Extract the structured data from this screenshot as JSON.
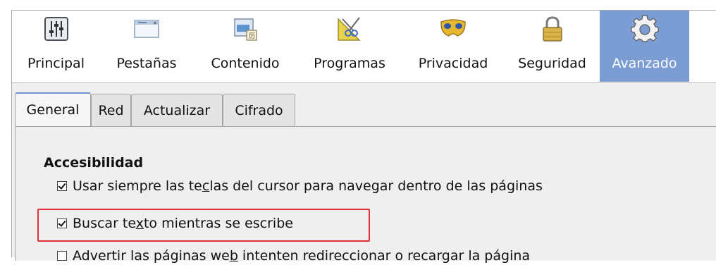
{
  "toolbar": {
    "items": [
      {
        "label": "Principal",
        "icon": "sliders-icon"
      },
      {
        "label": "Pestañas",
        "icon": "tabs-icon"
      },
      {
        "label": "Contenido",
        "icon": "content-icon"
      },
      {
        "label": "Programas",
        "icon": "applications-icon"
      },
      {
        "label": "Privacidad",
        "icon": "mask-icon"
      },
      {
        "label": "Seguridad",
        "icon": "padlock-icon"
      },
      {
        "label": "Avanzado",
        "icon": "gear-icon"
      }
    ],
    "selected": "Avanzado",
    "selected_color": "#7b9dd4"
  },
  "tabs": {
    "items": [
      "General",
      "Red",
      "Actualizar",
      "Cifrado"
    ],
    "active": "General"
  },
  "section": {
    "title": "Accesibilidad"
  },
  "options": [
    {
      "pre": "Usar siempre las te",
      "accel": "c",
      "post": "las del cursor para navegar dentro de las páginas",
      "checked": true
    },
    {
      "pre": "Buscar te",
      "accel": "x",
      "post": "to mientras se escribe",
      "checked": true
    },
    {
      "pre": "Advertir las páginas we",
      "accel": "b",
      "post": " intenten redireccionar o recargar la página",
      "checked": false
    }
  ],
  "highlight_color": "#e0303a"
}
